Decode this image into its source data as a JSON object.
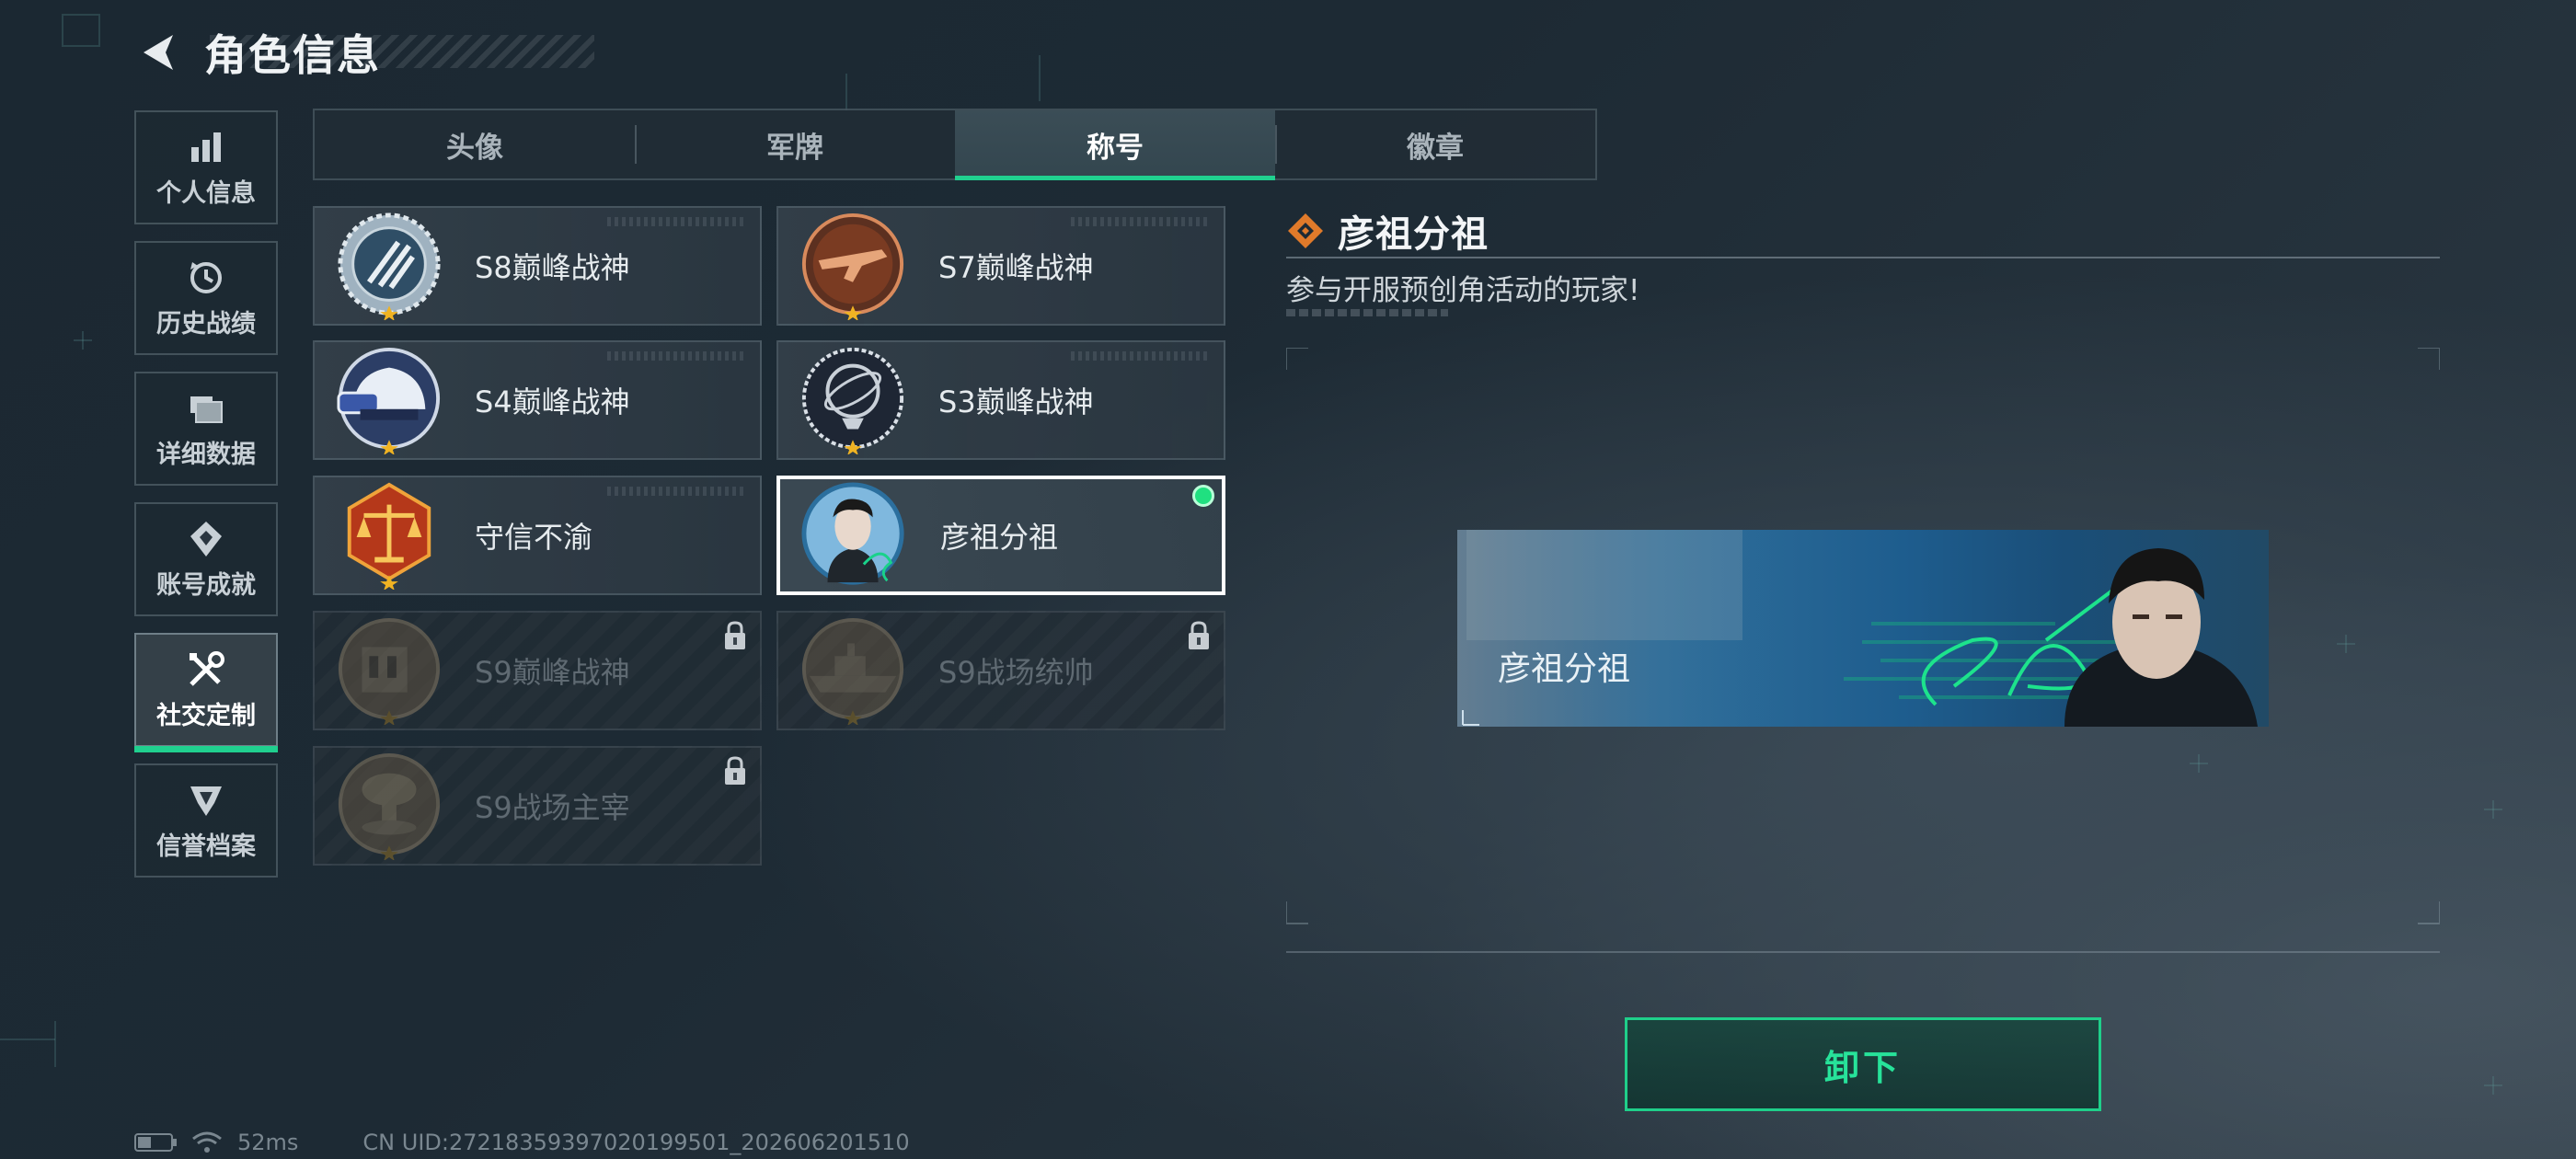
{
  "header": {
    "title": "角色信息"
  },
  "sidebar": {
    "items": [
      {
        "label": "个人信息",
        "icon": "bar-chart-icon"
      },
      {
        "label": "历史战绩",
        "icon": "history-icon"
      },
      {
        "label": "详细数据",
        "icon": "folder-icon"
      },
      {
        "label": "账号成就",
        "icon": "achievement-icon"
      },
      {
        "label": "社交定制",
        "icon": "tools-icon",
        "active": true
      },
      {
        "label": "信誉档案",
        "icon": "credit-shield-icon"
      }
    ]
  },
  "tabs": [
    {
      "label": "头像"
    },
    {
      "label": "军牌"
    },
    {
      "label": "称号",
      "active": true
    },
    {
      "label": "徽章"
    }
  ],
  "titles": [
    {
      "label": "S8巅峰战神",
      "locked": false,
      "emblem": "s8-emblem-icon"
    },
    {
      "label": "S7巅峰战神",
      "locked": false,
      "emblem": "s7-emblem-icon"
    },
    {
      "label": "S4巅峰战神",
      "locked": false,
      "emblem": "s4-emblem-icon"
    },
    {
      "label": "S3巅峰战神",
      "locked": false,
      "emblem": "s3-emblem-icon"
    },
    {
      "label": "守信不渝",
      "locked": false,
      "emblem": "scales-emblem-icon"
    },
    {
      "label": "彦祖分祖",
      "locked": false,
      "selected": true,
      "equipped": true,
      "emblem": "portrait-emblem-icon"
    },
    {
      "label": "S9巅峰战神",
      "locked": true,
      "emblem": "s9-emblem-icon"
    },
    {
      "label": "S9战场统帅",
      "locked": true,
      "emblem": "ship-emblem-icon"
    },
    {
      "label": "S9战场主宰",
      "locked": true,
      "emblem": "mushroom-cloud-emblem-icon"
    }
  ],
  "detail": {
    "title": "彦祖分祖",
    "description": "参与开服预创角活动的玩家!",
    "banner_label": "彦祖分祖",
    "action_label": "卸下"
  },
  "status": {
    "ping": "52ms",
    "uid": "CN UID:27218359397020199501_202606201510"
  },
  "colors": {
    "accent": "#20d08f",
    "diamond": "#e07a2a"
  }
}
